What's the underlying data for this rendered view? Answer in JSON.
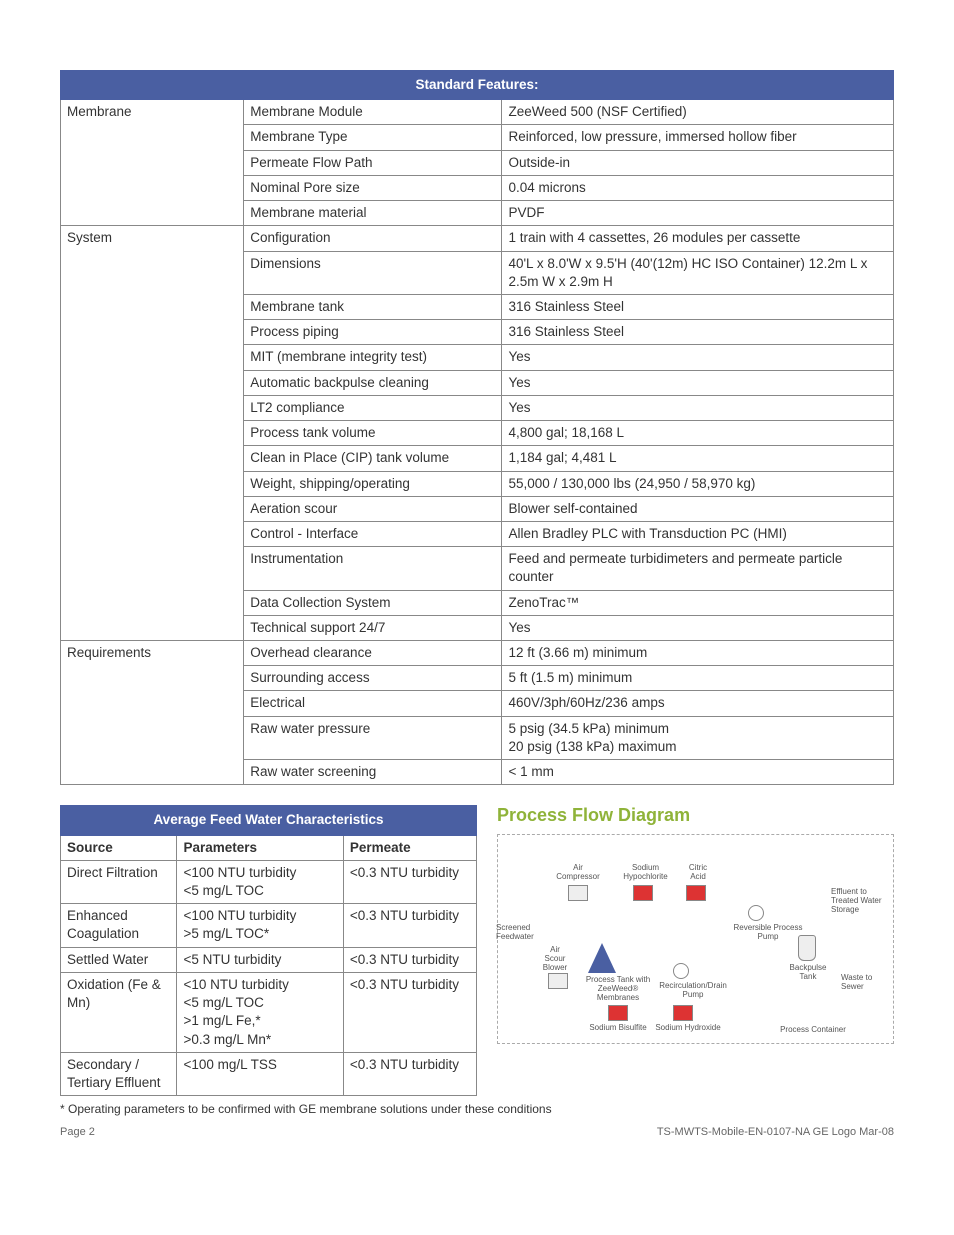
{
  "features_title": "Standard Features:",
  "features": {
    "cols": [
      "",
      "",
      ""
    ],
    "groups": [
      {
        "label": "Membrane",
        "rows": [
          [
            "Membrane Module",
            "ZeeWeed 500 (NSF Certified)"
          ],
          [
            "Membrane Type",
            "Reinforced, low pressure, immersed hollow fiber"
          ],
          [
            "Permeate Flow Path",
            "Outside-in"
          ],
          [
            "Nominal Pore size",
            "0.04 microns"
          ],
          [
            "Membrane material",
            "PVDF"
          ]
        ]
      },
      {
        "label": "System",
        "rows": [
          [
            "Configuration",
            "1 train with 4 cassettes, 26 modules per cassette"
          ],
          [
            "Dimensions",
            "40'L x 8.0'W x 9.5'H  (40'(12m) HC ISO Container) 12.2m L x 2.5m W x 2.9m H"
          ],
          [
            "Membrane tank",
            "316 Stainless Steel"
          ],
          [
            "Process piping",
            "316 Stainless Steel"
          ],
          [
            "MIT (membrane integrity test)",
            "Yes"
          ],
          [
            "Automatic backpulse cleaning",
            "Yes"
          ],
          [
            "LT2 compliance",
            "Yes"
          ],
          [
            "Process tank volume",
            "4,800 gal; 18,168 L"
          ],
          [
            "Clean in Place (CIP) tank volume",
            "1,184 gal; 4,481 L"
          ],
          [
            "Weight, shipping/operating",
            "55,000 / 130,000 lbs (24,950 / 58,970 kg)"
          ],
          [
            "Aeration scour",
            "Blower self-contained"
          ],
          [
            "Control - Interface",
            "Allen Bradley PLC with Transduction PC (HMI)"
          ],
          [
            "Instrumentation",
            "Feed and permeate turbidimeters and permeate particle counter"
          ],
          [
            "Data Collection System",
            "ZenoTrac™"
          ],
          [
            "Technical support 24/7",
            "Yes"
          ]
        ]
      },
      {
        "label": "Requirements",
        "rows": [
          [
            "Overhead clearance",
            "12 ft (3.66 m) minimum"
          ],
          [
            "Surrounding access",
            "5 ft (1.5 m) minimum"
          ],
          [
            "Electrical",
            "460V/3ph/60Hz/236 amps"
          ],
          [
            "Raw water pressure",
            "5 psig (34.5 kPa) minimum\n20 psig (138 kPa) maximum"
          ],
          [
            "Raw water screening",
            "< 1 mm"
          ]
        ]
      }
    ]
  },
  "feedwater_title": "Average Feed Water Characteristics",
  "feedwater_headers": [
    "Source",
    "Parameters",
    "Permeate"
  ],
  "feedwater_rows": [
    [
      "Direct Filtration",
      "<100 NTU turbidity\n<5 mg/L TOC",
      "<0.3 NTU turbidity"
    ],
    [
      "Enhanced Coagulation",
      "<100 NTU turbidity\n>5 mg/L TOC*",
      "<0.3 NTU turbidity"
    ],
    [
      "Settled Water",
      "<5 NTU turbidity",
      "<0.3 NTU turbidity"
    ],
    [
      "Oxidation (Fe & Mn)",
      "<10 NTU turbidity\n<5 mg/L TOC\n>1 mg/L Fe,*\n>0.3 mg/L Mn*",
      "<0.3 NTU turbidity"
    ],
    [
      "Secondary / Tertiary Effluent",
      "<100 mg/L TSS",
      "<0.3 NTU turbidity"
    ]
  ],
  "footnote": "* Operating parameters to be confirmed with GE membrane solutions under these conditions",
  "flow_title": "Process Flow Diagram",
  "flow": {
    "air_compressor": "Air\nCompressor",
    "sodium_hypo": "Sodium\nHypochlorite",
    "citric_acid": "Citric\nAcid",
    "effluent": "Effluent to\nTreated Water\nStorage",
    "reversible_pump": "Reversible Process\nPump",
    "screened_feedwater": "Screened\nFeedwater",
    "air_scour": "Air\nScour\nBlower",
    "process_tank": "Process Tank with\nZeeWeed®\nMembranes",
    "recirc": "Recirculation/Drain\nPump",
    "backpulse_tank": "Backpulse\nTank",
    "waste": "Waste to\nSewer",
    "sodium_bisulfite": "Sodium Bisulfite",
    "sodium_hydroxide": "Sodium Hydroxide",
    "process_container": "Process Container"
  },
  "footer_left": "Page 2",
  "footer_right": "TS-MWTS-Mobile-EN-0107-NA GE Logo Mar-08"
}
